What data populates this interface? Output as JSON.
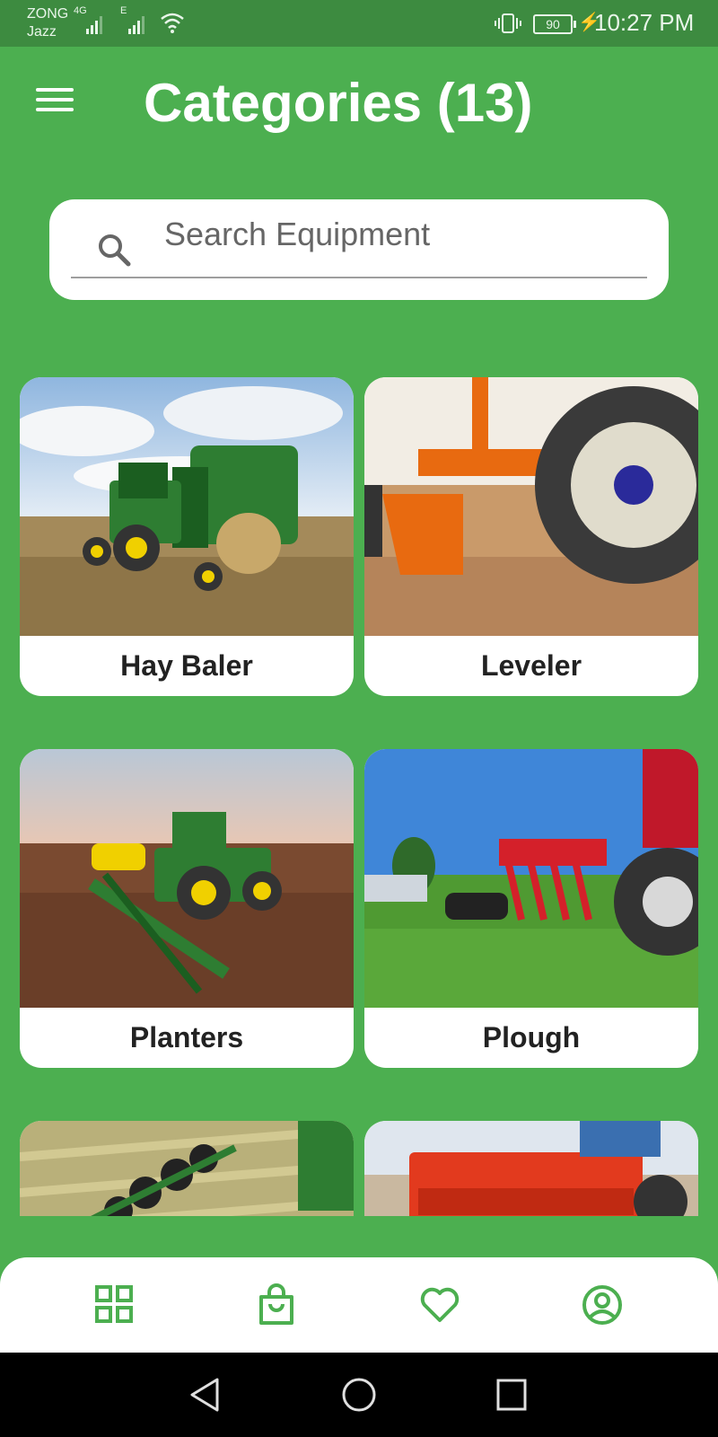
{
  "status_bar": {
    "carrier_1": "ZONG",
    "carrier_2": "Jazz",
    "network_1": "4G",
    "network_2": "E",
    "battery": "90",
    "time": "10:27 PM"
  },
  "header": {
    "title": "Categories (13)"
  },
  "search": {
    "placeholder": "Search Equipment",
    "value": ""
  },
  "categories": [
    {
      "label": "Hay Baler"
    },
    {
      "label": "Leveler"
    },
    {
      "label": "Planters"
    },
    {
      "label": "Plough"
    },
    {
      "label": ""
    },
    {
      "label": ""
    }
  ],
  "bottom_nav": {
    "items": [
      "grid-icon",
      "shopping-bag-icon",
      "heart-icon",
      "account-icon"
    ],
    "accent": "#4caf50"
  },
  "colors": {
    "primary": "#4caf50",
    "status_bar": "#3d8b40"
  }
}
